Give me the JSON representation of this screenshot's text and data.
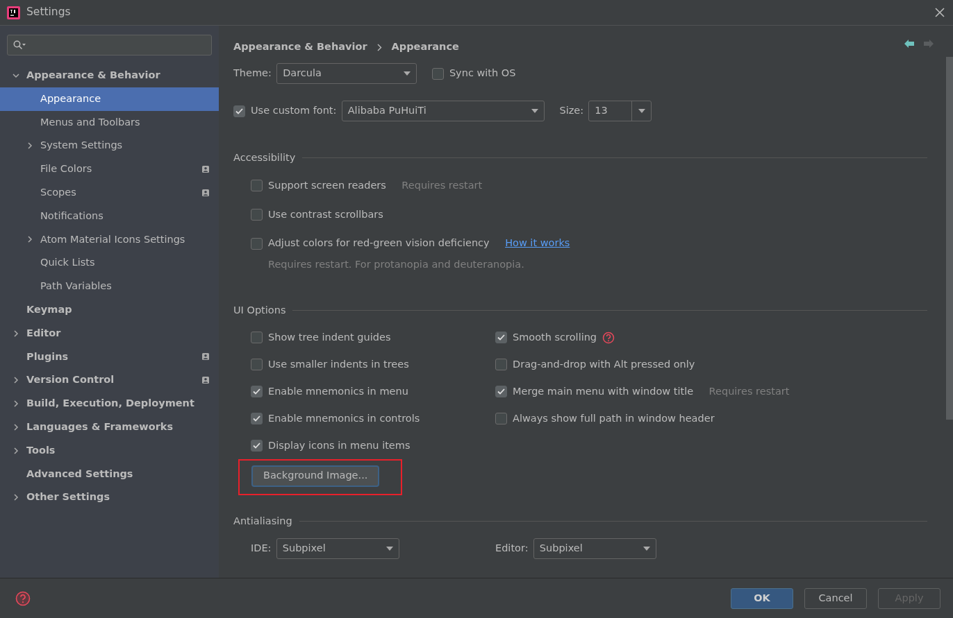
{
  "window": {
    "title": "Settings"
  },
  "sidebar": {
    "items": [
      {
        "label": "Appearance & Behavior",
        "expandable": true,
        "expanded": true,
        "selected": false,
        "badge": false,
        "children": [
          {
            "label": "Appearance",
            "expandable": false,
            "selected": true,
            "badge": false
          },
          {
            "label": "Menus and Toolbars",
            "expandable": false,
            "selected": false,
            "badge": false
          },
          {
            "label": "System Settings",
            "expandable": true,
            "expanded": false,
            "selected": false,
            "badge": false
          },
          {
            "label": "File Colors",
            "expandable": false,
            "selected": false,
            "badge": true
          },
          {
            "label": "Scopes",
            "expandable": false,
            "selected": false,
            "badge": true
          },
          {
            "label": "Notifications",
            "expandable": false,
            "selected": false,
            "badge": false
          },
          {
            "label": "Atom Material Icons Settings",
            "expandable": true,
            "expanded": false,
            "selected": false,
            "badge": false
          },
          {
            "label": "Quick Lists",
            "expandable": false,
            "selected": false,
            "badge": false
          },
          {
            "label": "Path Variables",
            "expandable": false,
            "selected": false,
            "badge": false
          }
        ]
      },
      {
        "label": "Keymap",
        "expandable": false,
        "selected": false,
        "badge": false
      },
      {
        "label": "Editor",
        "expandable": true,
        "expanded": false,
        "selected": false,
        "badge": false
      },
      {
        "label": "Plugins",
        "expandable": false,
        "selected": false,
        "badge": true
      },
      {
        "label": "Version Control",
        "expandable": true,
        "expanded": false,
        "selected": false,
        "badge": true
      },
      {
        "label": "Build, Execution, Deployment",
        "expandable": true,
        "expanded": false,
        "selected": false,
        "badge": false
      },
      {
        "label": "Languages & Frameworks",
        "expandable": true,
        "expanded": false,
        "selected": false,
        "badge": false
      },
      {
        "label": "Tools",
        "expandable": true,
        "expanded": false,
        "selected": false,
        "badge": false
      },
      {
        "label": "Advanced Settings",
        "expandable": false,
        "selected": false,
        "badge": false
      },
      {
        "label": "Other Settings",
        "expandable": true,
        "expanded": false,
        "selected": false,
        "badge": false
      }
    ]
  },
  "breadcrumb": [
    "Appearance & Behavior",
    "Appearance"
  ],
  "theme": {
    "label": "Theme:",
    "value": "Darcula"
  },
  "sync_with_os": {
    "label": "Sync with OS",
    "checked": false
  },
  "custom_font": {
    "label": "Use custom font:",
    "checked": true,
    "value": "Alibaba PuHuiTi",
    "size_label": "Size:",
    "size": "13"
  },
  "accessibility": {
    "title": "Accessibility",
    "options": [
      {
        "label": "Support screen readers",
        "checked": false,
        "hint": "Requires restart"
      },
      {
        "label": "Use contrast scrollbars",
        "checked": false
      },
      {
        "label": "Adjust colors for red-green vision deficiency",
        "checked": false,
        "link": "How it works",
        "note": "Requires restart. For protanopia and deuteranopia."
      }
    ]
  },
  "ui_options": {
    "title": "UI Options",
    "columns": [
      [
        {
          "label": "Show tree indent guides",
          "checked": false
        },
        {
          "label": "Use smaller indents in trees",
          "checked": false
        },
        {
          "label": "Enable mnemonics in menu",
          "checked": true
        },
        {
          "label": "Enable mnemonics in controls",
          "checked": true
        },
        {
          "label": "Display icons in menu items",
          "checked": true
        }
      ],
      [
        {
          "label": "Smooth scrolling",
          "checked": true,
          "help": true
        },
        {
          "label": "Drag-and-drop with Alt pressed only",
          "checked": false
        },
        {
          "label": "Merge main menu with window title",
          "checked": true,
          "hint": "Requires restart"
        },
        {
          "label": "Always show full path in window header",
          "checked": false
        }
      ]
    ],
    "background_button": {
      "label": "Background Image...",
      "highlighted": true
    }
  },
  "antialiasing": {
    "title": "Antialiasing",
    "ide": {
      "label": "IDE:",
      "value": "Subpixel"
    },
    "editor": {
      "label": "Editor:",
      "value": "Subpixel"
    }
  },
  "footer": {
    "buttons": [
      {
        "label": "OK",
        "kind": "primary",
        "disabled": false
      },
      {
        "label": "Cancel",
        "kind": "secondary",
        "disabled": false
      },
      {
        "label": "Apply",
        "kind": "secondary",
        "disabled": true
      }
    ]
  }
}
